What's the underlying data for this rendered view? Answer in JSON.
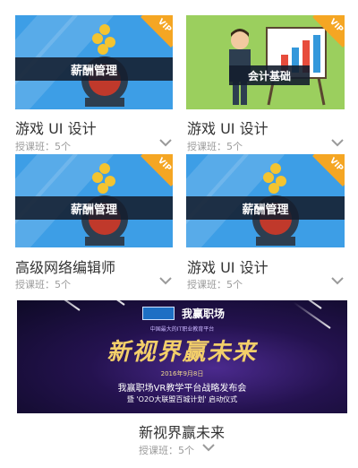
{
  "courses": [
    {
      "thumb_label": "薪酬管理",
      "title": "游戏 UI 设计",
      "meta": "授课班：5个",
      "vip": "VIP"
    },
    {
      "thumb_label": "会计基础",
      "title": "游戏 UI 设计",
      "meta": "授课班：5个",
      "vip": "VIP"
    },
    {
      "thumb_label": "薪酬管理",
      "title": "高级网络编辑师",
      "meta": "授课班：5个",
      "vip": "VIP"
    },
    {
      "thumb_label": "薪酬管理",
      "title": "游戏 UI 设计",
      "meta": "授课班：5个",
      "vip": "VIP"
    }
  ],
  "featured": {
    "brand": "我赢职场",
    "small_caption": "中国最大的IT职业教育平台",
    "headline": "新视界赢未来",
    "date": "2016年9月8日",
    "subtitle": "我赢职场VR教学平台战略发布会",
    "subtitle2": "暨 'O2O大联盟百城计划' 启动仪式",
    "title": "新视界赢未来",
    "meta": "授课班：5个"
  },
  "colors": {
    "blue_thumb": "#3d9ee6",
    "green_thumb": "#9bcf5e",
    "vip_badge": "#f5a623"
  }
}
